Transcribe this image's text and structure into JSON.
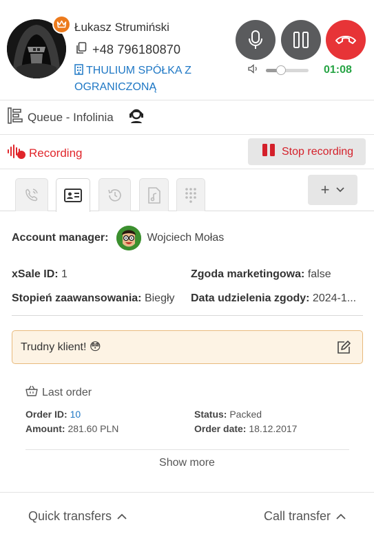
{
  "caller": {
    "name": "Łukasz Strumiński",
    "phone": "+48 796180870",
    "company": "THULIUM SPÓŁKA Z OGRANICZONĄ"
  },
  "call": {
    "timer": "01:08",
    "volume_level": 0.35
  },
  "queue": {
    "label": "Queue - Infolinia"
  },
  "recording": {
    "status_label": "Recording",
    "stop_label": "Stop recording"
  },
  "tabs": [
    {
      "icon": "phone-wave-icon",
      "active": false
    },
    {
      "icon": "contact-card-icon",
      "active": true
    },
    {
      "icon": "history-icon",
      "active": false
    },
    {
      "icon": "audio-file-icon",
      "active": false
    },
    {
      "icon": "dialpad-icon",
      "active": false
    }
  ],
  "add_menu": {
    "label": "+"
  },
  "contact": {
    "account_manager_label": "Account manager:",
    "account_manager_name": "Wojciech Mołas",
    "xsale_label": "xSale ID:",
    "xsale_value": "1",
    "zgoda_label": "Zgoda marketingowa:",
    "zgoda_value": "false",
    "stopien_label": "Stopień zaawansowania:",
    "stopien_value": "Biegły",
    "data_label": "Data udzielenia zgody:",
    "data_value": "2024-1..."
  },
  "note": {
    "text": "Trudny klient! 😳"
  },
  "last_order": {
    "title": "Last order",
    "order_id_label": "Order ID:",
    "order_id_value": "10",
    "status_label": "Status:",
    "status_value": "Packed",
    "amount_label": "Amount:",
    "amount_value": "281.60 PLN",
    "order_date_label": "Order date:",
    "order_date_value": "18.12.2017",
    "show_more": "Show more"
  },
  "footer": {
    "quick_transfers": "Quick transfers",
    "call_transfer": "Call transfer"
  },
  "colors": {
    "accent_blue": "#1f78c5",
    "hangup_red": "#e73437",
    "recording_red": "#e0262b",
    "timer_green": "#27a445",
    "crown_orange": "#ec7a1c",
    "note_bg": "#fdf3e4"
  }
}
